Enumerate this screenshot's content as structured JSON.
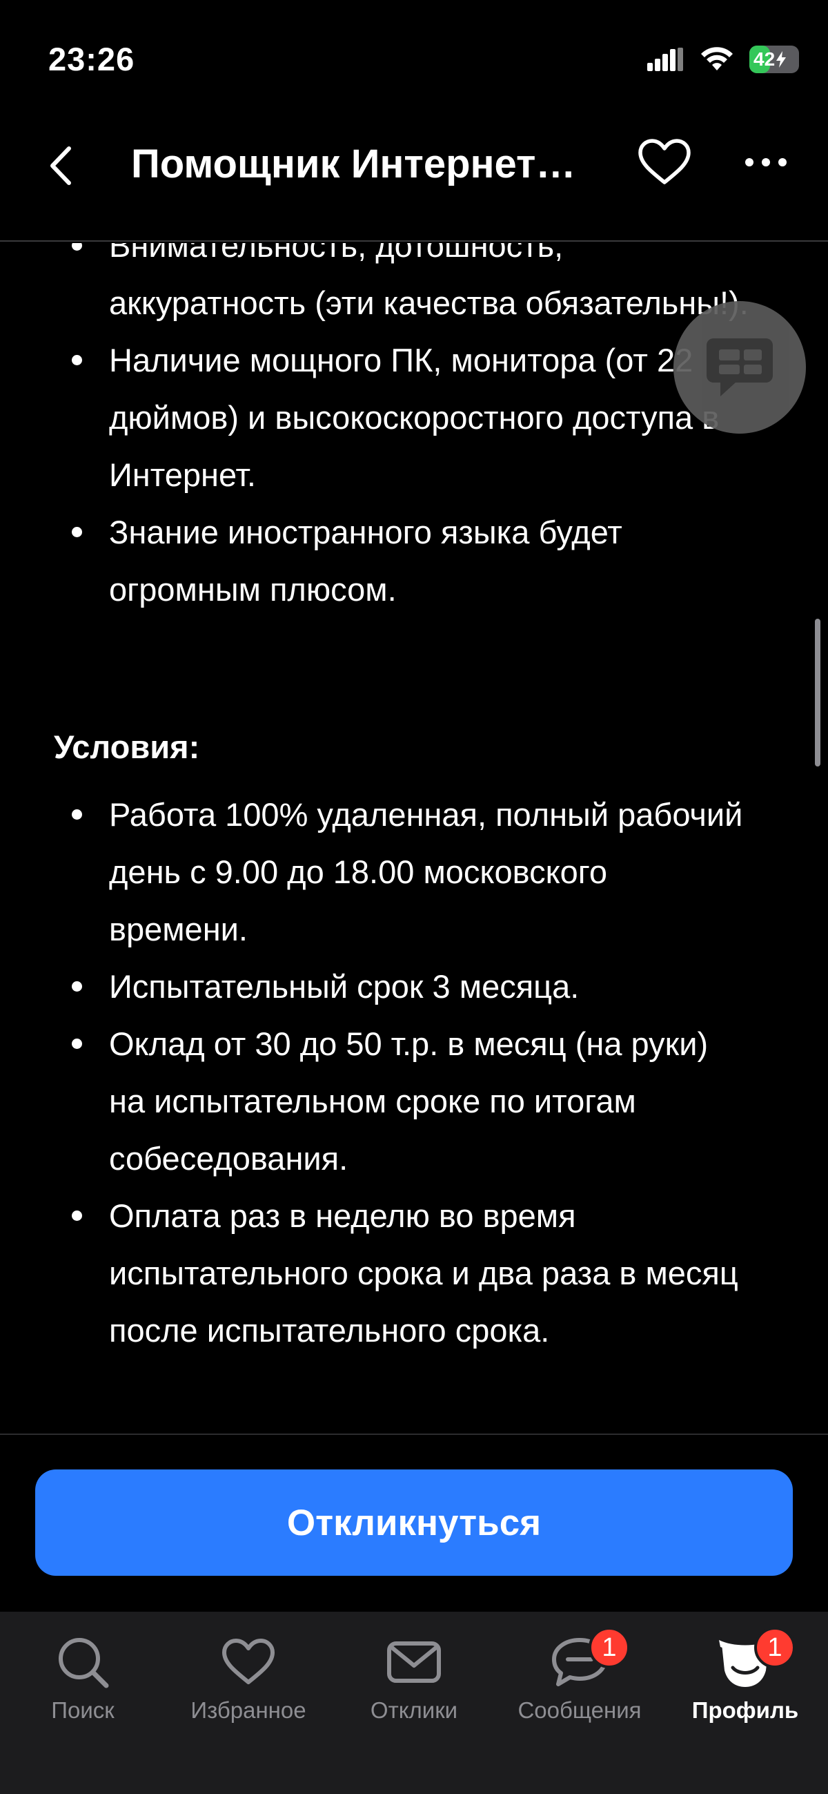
{
  "status_bar": {
    "time": "23:26",
    "battery_level": "42",
    "battery_percent": 42
  },
  "header": {
    "title": "Помощник Интернет…"
  },
  "requirements": {
    "items": [
      "Внимательность, дотошность, аккуратность (эти качества обязательны!).",
      "Наличие мощного ПК, монитора (от 22 дюймов) и высокоскоростного доступа в Интернет.",
      "Знание иностранного языка будет огромным плюсом."
    ]
  },
  "conditions": {
    "title": "Условия:",
    "items": [
      "Работа 100% удаленная, полный рабочий день с 9.00 до 18.00 московского времени.",
      "Испытательный срок 3 месяца.",
      "Оклад от 30 до 50 т.р. в месяц (на руки) на испытательном сроке по итогам собеседования.",
      "Оплата раз в неделю во время испытательного срока и два раза в месяц после испытательного срока."
    ]
  },
  "apply_button": {
    "label": "Откликнуться",
    "color": "#2b7cff"
  },
  "tabbar": {
    "tabs": [
      {
        "label": "Поиск",
        "icon": "search-icon"
      },
      {
        "label": "Избранное",
        "icon": "heart-icon"
      },
      {
        "label": "Отклики",
        "icon": "envelope-icon"
      },
      {
        "label": "Сообщения",
        "icon": "chat-icon",
        "badge": "1"
      },
      {
        "label": "Профиль",
        "icon": "profile-icon",
        "badge": "1",
        "active": true
      }
    ]
  }
}
